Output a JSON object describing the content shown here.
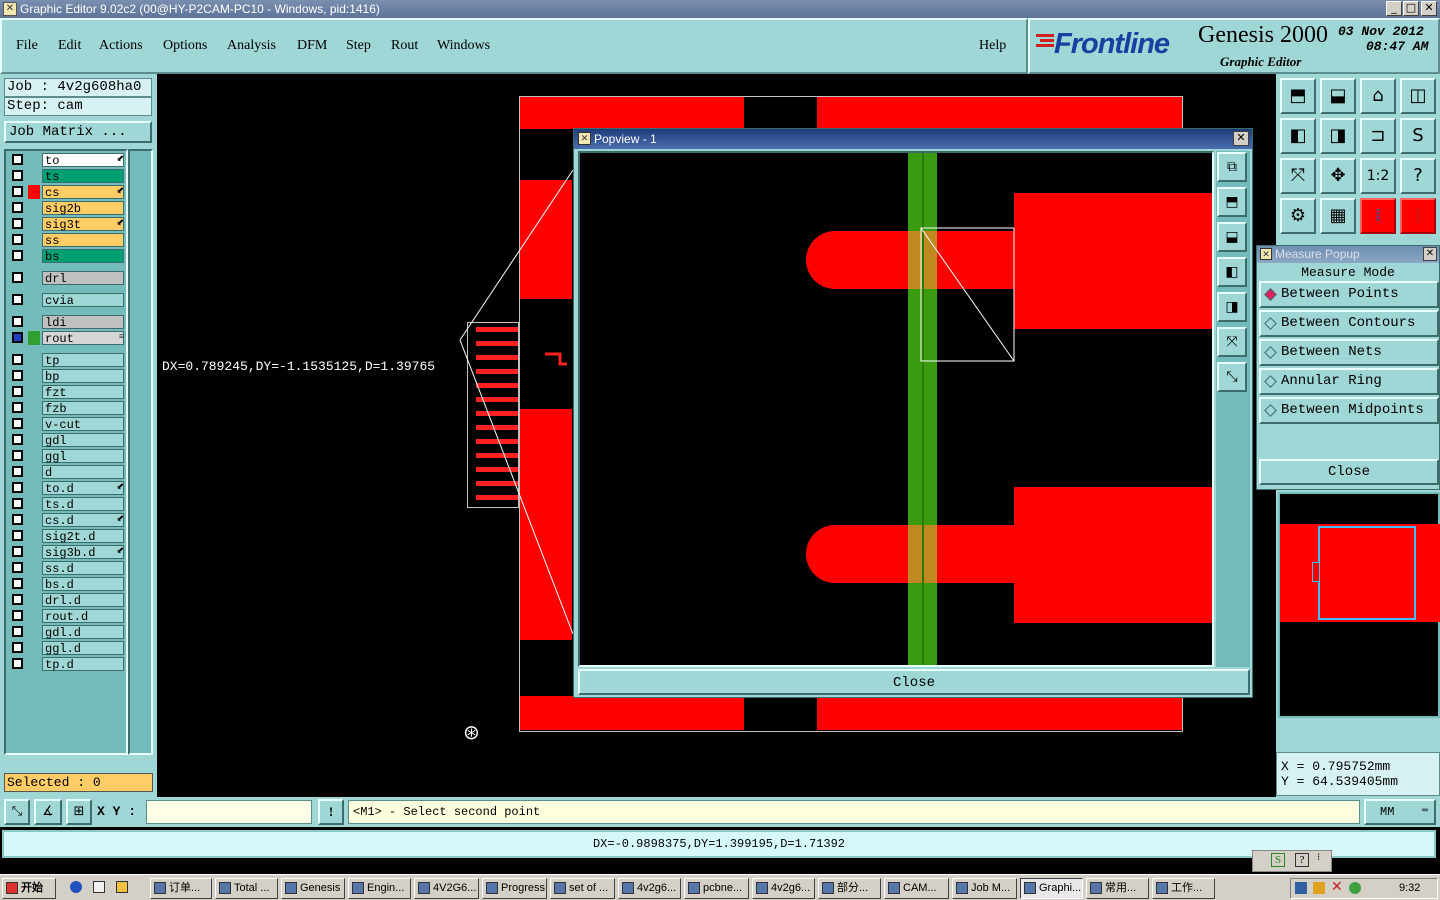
{
  "window": {
    "title": "Graphic Editor 9.02c2 (00@HY-P2CAM-PC10 - Windows, pid:1416)"
  },
  "menu": {
    "file": "File",
    "edit": "Edit",
    "actions": "Actions",
    "options": "Options",
    "analysis": "Analysis",
    "dfm": "DFM",
    "step": "Step",
    "rout": "Rout",
    "windows": "Windows",
    "help": "Help"
  },
  "branding": {
    "logo": "Frontline",
    "product": "Genesis 2000",
    "subtitle": "Graphic Editor",
    "date": "03  Nov  2012",
    "time": "08:47  AM"
  },
  "job": {
    "job_line": "Job : 4v2g608ha0",
    "step_line": "Step: cam",
    "matrix_button": "Job Matrix ..."
  },
  "layers": [
    {
      "name": "to",
      "color": "#ffffff",
      "flag": "⬋",
      "mark": ""
    },
    {
      "name": "ts",
      "color": "#00a070",
      "flag": "",
      "mark": ""
    },
    {
      "name": "cs",
      "color": "#ffcc66",
      "flag": "⬋",
      "mark": "#ff0000"
    },
    {
      "name": "sig2b",
      "color": "#ffcc66",
      "flag": "",
      "mark": ""
    },
    {
      "name": "sig3t",
      "color": "#ffcc66",
      "flag": "⬋",
      "mark": ""
    },
    {
      "name": "ss",
      "color": "#ffcc66",
      "flag": "",
      "mark": ""
    },
    {
      "name": "bs",
      "color": "#00a070",
      "flag": "",
      "mark": ""
    },
    {
      "name": "drl",
      "color": "#c0c0c0",
      "flag": "",
      "mark": ""
    },
    {
      "name": "cvia",
      "color": "#9fd6d6",
      "flag": "",
      "mark": ""
    },
    {
      "name": "ldi",
      "color": "#c0c0c0",
      "flag": "",
      "mark": ""
    },
    {
      "name": "rout",
      "color": "#d6d6d6",
      "flag": "≡",
      "mark": "#30a030"
    },
    {
      "name": "tp",
      "color": "#9fd6d6",
      "flag": "",
      "mark": ""
    },
    {
      "name": "bp",
      "color": "#9fd6d6",
      "flag": "",
      "mark": ""
    },
    {
      "name": "fzt",
      "color": "#9fd6d6",
      "flag": "",
      "mark": ""
    },
    {
      "name": "fzb",
      "color": "#9fd6d6",
      "flag": "",
      "mark": ""
    },
    {
      "name": "v-cut",
      "color": "#9fd6d6",
      "flag": "",
      "mark": ""
    },
    {
      "name": "gdl",
      "color": "#9fd6d6",
      "flag": "",
      "mark": ""
    },
    {
      "name": "ggl",
      "color": "#9fd6d6",
      "flag": "",
      "mark": ""
    },
    {
      "name": "d",
      "color": "#9fd6d6",
      "flag": "",
      "mark": ""
    },
    {
      "name": "to.d",
      "color": "#9fd6d6",
      "flag": "⬋",
      "mark": ""
    },
    {
      "name": "ts.d",
      "color": "#9fd6d6",
      "flag": "",
      "mark": ""
    },
    {
      "name": "cs.d",
      "color": "#9fd6d6",
      "flag": "⬋",
      "mark": ""
    },
    {
      "name": "sig2t.d",
      "color": "#9fd6d6",
      "flag": "",
      "mark": ""
    },
    {
      "name": "sig3b.d",
      "color": "#9fd6d6",
      "flag": "⬋",
      "mark": ""
    },
    {
      "name": "ss.d",
      "color": "#9fd6d6",
      "flag": "",
      "mark": ""
    },
    {
      "name": "bs.d",
      "color": "#9fd6d6",
      "flag": "",
      "mark": ""
    },
    {
      "name": "drl.d",
      "color": "#9fd6d6",
      "flag": "",
      "mark": ""
    },
    {
      "name": "rout.d",
      "color": "#9fd6d6",
      "flag": "",
      "mark": ""
    },
    {
      "name": "gdl.d",
      "color": "#9fd6d6",
      "flag": "",
      "mark": ""
    },
    {
      "name": "ggl.d",
      "color": "#9fd6d6",
      "flag": "",
      "mark": ""
    },
    {
      "name": "tp.d",
      "color": "#9fd6d6",
      "flag": "",
      "mark": ""
    }
  ],
  "selected": "Selected : 0",
  "canvas": {
    "measure_readout": "DX=0.789245,DY=-1.1535125,D=1.39765"
  },
  "popview": {
    "title": "Popview - 1",
    "close": "Close"
  },
  "measure": {
    "title": "Measure Popup",
    "header": "Measure Mode",
    "options": [
      "Between Points",
      "Between Contours",
      "Between Nets",
      "Annular Ring",
      "Between Midpoints"
    ],
    "selected_index": 0,
    "close": "Close"
  },
  "coords": {
    "x": "X  =  0.795752mm",
    "y": "Y  =  64.539405mm"
  },
  "cmd": {
    "xy_label": "X Y :",
    "input_value": "",
    "prompt": "<M1> - Select second point",
    "units": "MM"
  },
  "status": "DX=-0.9898375,DY=1.399195,D=1.71392",
  "taskbar": {
    "start": "开始",
    "tasks": [
      "订单...",
      "Total ...",
      "Genesis",
      "Engin...",
      "4V2G6...",
      "Progress",
      "set of ...",
      "4v2g6...",
      "pcbne...",
      "4v2g6...",
      "部分...",
      "CAM...",
      "Job M...",
      "Graphi...",
      "常用...",
      "工作..."
    ],
    "active_index": 13,
    "clock": "9:32"
  },
  "colors": {
    "panel": "#9fd6d6",
    "copper": "#ff0000",
    "rout": "#3a9a10",
    "selected": "#ffcc66"
  }
}
